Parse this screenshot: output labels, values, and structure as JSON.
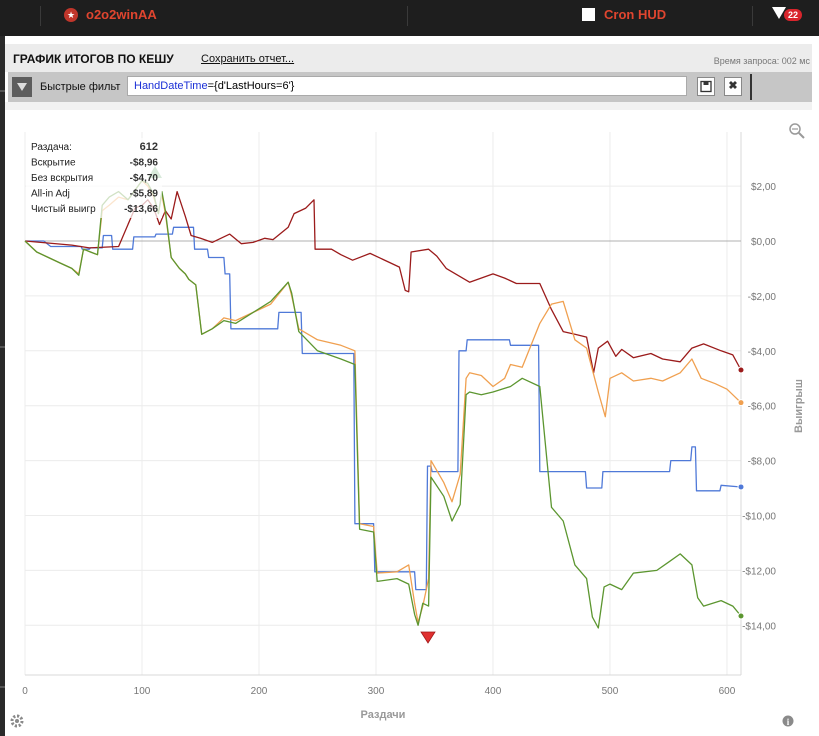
{
  "topbar": {
    "player": "o2o2winAA",
    "hud_label": "Cron HUD",
    "badge_count": "22"
  },
  "header": {
    "title": "ГРАФИК ИТОГОВ ПО КЕШУ",
    "save_link": "Сохранить отчет...",
    "query_time": "Время запроса: 002 мс"
  },
  "filter": {
    "label": "Быстрые фильт",
    "field": "HandDateTime",
    "value": "{d'LastHours=6'}"
  },
  "tooltip": {
    "rows": [
      {
        "label": "Раздача:",
        "value": "612"
      },
      {
        "label": "Вскрытие",
        "value": "-$8,96"
      },
      {
        "label": "Без вскрытия",
        "value": "-$4,70"
      },
      {
        "label": "All-in Adj",
        "value": "-$5,89"
      },
      {
        "label": "Чистый выигр",
        "value": "-$13,66"
      }
    ]
  },
  "colors": {
    "showdown": "#4f79d8",
    "non_showdown": "#9b1b1b",
    "allin_adj": "#f0a050",
    "net": "#5c9630",
    "zero_line": "#b0b0b0",
    "grid": "#ececec"
  },
  "chart_data": {
    "type": "line",
    "xlabel": "Раздачи",
    "ylabel": "Выигрыш",
    "xlim": [
      0,
      612
    ],
    "ylim": [
      -15,
      3
    ],
    "x_ticks": [
      0,
      100,
      200,
      300,
      400,
      500,
      600
    ],
    "x_tick_labels": [
      "0",
      "100",
      "200",
      "300",
      "400",
      "500",
      "600"
    ],
    "y_ticks": [
      2,
      0,
      -2,
      -4,
      -6,
      -8,
      -10,
      -12,
      -14
    ],
    "y_tick_labels": [
      "$2,00",
      "$0,00",
      "-$2,00",
      "-$4,00",
      "-$6,00",
      "-$8,00",
      "-$10,00",
      "-$12,00",
      "-$14,00"
    ],
    "grid": true,
    "series": [
      {
        "name": "Вскрытие",
        "color": "#4f79d8",
        "points": [
          [
            0,
            0
          ],
          [
            16,
            0
          ],
          [
            22,
            -0.2
          ],
          [
            48,
            -0.2
          ],
          [
            49,
            -0.3
          ],
          [
            55,
            -0.3
          ],
          [
            56,
            -0.25
          ],
          [
            66,
            -0.25
          ],
          [
            67,
            0.2
          ],
          [
            74,
            0.2
          ],
          [
            75,
            -0.3
          ],
          [
            92,
            -0.3
          ],
          [
            93,
            0.15
          ],
          [
            111,
            0.15
          ],
          [
            112,
            0.25
          ],
          [
            126,
            0.25
          ],
          [
            127,
            0.5
          ],
          [
            144,
            0.5
          ],
          [
            145,
            -0.3
          ],
          [
            156,
            -0.3
          ],
          [
            157,
            -0.6
          ],
          [
            170,
            -0.6
          ],
          [
            171,
            -1.2
          ],
          [
            175,
            -1.2
          ],
          [
            176,
            -3.2
          ],
          [
            216,
            -3.2
          ],
          [
            217,
            -2.6
          ],
          [
            236,
            -2.6
          ],
          [
            237,
            -4.1
          ],
          [
            281,
            -4.1
          ],
          [
            282,
            -10.3
          ],
          [
            298,
            -10.3
          ],
          [
            299,
            -12.05
          ],
          [
            333,
            -12.05
          ],
          [
            334,
            -12.7
          ],
          [
            343,
            -12.7
          ],
          [
            344,
            -8.2
          ],
          [
            347,
            -8.2
          ],
          [
            348,
            -8.4
          ],
          [
            370,
            -8.4
          ],
          [
            371,
            -4.0
          ],
          [
            377,
            -4.0
          ],
          [
            378,
            -3.6
          ],
          [
            414,
            -3.6
          ],
          [
            415,
            -3.8
          ],
          [
            439,
            -3.8
          ],
          [
            440,
            -8.4
          ],
          [
            479,
            -8.4
          ],
          [
            480,
            -9.0
          ],
          [
            493,
            -9.0
          ],
          [
            494,
            -8.4
          ],
          [
            551,
            -8.4
          ],
          [
            552,
            -8.0
          ],
          [
            569,
            -8.0
          ],
          [
            570,
            -7.5
          ],
          [
            573,
            -7.5
          ],
          [
            574,
            -9.1
          ],
          [
            594,
            -9.1
          ],
          [
            595,
            -8.9
          ],
          [
            612,
            -8.96
          ]
        ]
      },
      {
        "name": "Без вскрытия",
        "color": "#9b1b1b",
        "points": [
          [
            0,
            0
          ],
          [
            40,
            -0.15
          ],
          [
            55,
            -0.25
          ],
          [
            80,
            -0.2
          ],
          [
            94,
            1.2
          ],
          [
            100,
            1.3
          ],
          [
            105,
            1.5
          ],
          [
            110,
            1.2
          ],
          [
            115,
            0.6
          ],
          [
            120,
            1.1
          ],
          [
            125,
            0.8
          ],
          [
            130,
            1.8
          ],
          [
            137,
            0.9
          ],
          [
            142,
            0.2
          ],
          [
            150,
            0.1
          ],
          [
            160,
            -0.05
          ],
          [
            175,
            0.25
          ],
          [
            185,
            -0.1
          ],
          [
            195,
            -0.05
          ],
          [
            205,
            0.1
          ],
          [
            212,
            0.05
          ],
          [
            225,
            0.5
          ],
          [
            230,
            1.0
          ],
          [
            240,
            1.2
          ],
          [
            247,
            1.5
          ],
          [
            248,
            -0.3
          ],
          [
            262,
            -0.3
          ],
          [
            270,
            -0.5
          ],
          [
            280,
            -0.7
          ],
          [
            295,
            -0.45
          ],
          [
            310,
            -0.75
          ],
          [
            320,
            -0.95
          ],
          [
            325,
            -1.8
          ],
          [
            328,
            -1.85
          ],
          [
            330,
            -0.4
          ],
          [
            345,
            -0.3
          ],
          [
            352,
            -0.55
          ],
          [
            360,
            -1.0
          ],
          [
            370,
            -1.25
          ],
          [
            380,
            -1.5
          ],
          [
            400,
            -1.2
          ],
          [
            410,
            -1.35
          ],
          [
            420,
            -1.55
          ],
          [
            440,
            -1.55
          ],
          [
            450,
            -2.5
          ],
          [
            460,
            -3.3
          ],
          [
            470,
            -3.4
          ],
          [
            480,
            -3.5
          ],
          [
            486,
            -4.8
          ],
          [
            490,
            -3.9
          ],
          [
            498,
            -3.65
          ],
          [
            505,
            -4.2
          ],
          [
            510,
            -3.95
          ],
          [
            520,
            -4.25
          ],
          [
            535,
            -4.1
          ],
          [
            545,
            -4.3
          ],
          [
            560,
            -4.4
          ],
          [
            570,
            -3.9
          ],
          [
            580,
            -3.75
          ],
          [
            595,
            -4.0
          ],
          [
            605,
            -4.15
          ],
          [
            612,
            -4.7
          ]
        ]
      },
      {
        "name": "All-in Adj",
        "color": "#f0a050",
        "points": [
          [
            0,
            0
          ],
          [
            10,
            -0.4
          ],
          [
            20,
            -0.6
          ],
          [
            30,
            -0.8
          ],
          [
            40,
            -1.0
          ],
          [
            46,
            -1.2
          ],
          [
            50,
            -0.3
          ],
          [
            56,
            -0.4
          ],
          [
            62,
            -0.5
          ],
          [
            66,
            1.1
          ],
          [
            72,
            1.3
          ],
          [
            80,
            1.6
          ],
          [
            88,
            1.5
          ],
          [
            95,
            1.9
          ],
          [
            100,
            2.2
          ],
          [
            105,
            2.0
          ],
          [
            110,
            1.6
          ],
          [
            114,
            1.0
          ],
          [
            117,
            1.7
          ],
          [
            120,
            1.0
          ],
          [
            125,
            -0.6
          ],
          [
            132,
            -1.0
          ],
          [
            137,
            -1.2
          ],
          [
            140,
            -1.4
          ],
          [
            146,
            -1.6
          ],
          [
            151,
            -3.4
          ],
          [
            160,
            -3.2
          ],
          [
            170,
            -2.8
          ],
          [
            180,
            -2.9
          ],
          [
            195,
            -2.6
          ],
          [
            210,
            -2.3
          ],
          [
            225,
            -1.5
          ],
          [
            228,
            -2.0
          ],
          [
            234,
            -3.2
          ],
          [
            250,
            -3.6
          ],
          [
            270,
            -3.8
          ],
          [
            282,
            -4.0
          ],
          [
            286,
            -10.3
          ],
          [
            298,
            -10.4
          ],
          [
            301,
            -12.1
          ],
          [
            318,
            -12.05
          ],
          [
            328,
            -11.8
          ],
          [
            333,
            -13.2
          ],
          [
            336,
            -13.9
          ],
          [
            340,
            -13.3
          ],
          [
            345,
            -12.3
          ],
          [
            347,
            -8.0
          ],
          [
            358,
            -8.8
          ],
          [
            365,
            -9.5
          ],
          [
            372,
            -8.5
          ],
          [
            377,
            -5.0
          ],
          [
            380,
            -4.8
          ],
          [
            390,
            -4.9
          ],
          [
            400,
            -5.3
          ],
          [
            410,
            -5.0
          ],
          [
            415,
            -4.5
          ],
          [
            425,
            -4.6
          ],
          [
            440,
            -3.0
          ],
          [
            450,
            -2.3
          ],
          [
            460,
            -2.2
          ],
          [
            470,
            -3.6
          ],
          [
            480,
            -3.9
          ],
          [
            490,
            -5.5
          ],
          [
            496,
            -6.4
          ],
          [
            500,
            -5.0
          ],
          [
            510,
            -4.8
          ],
          [
            520,
            -5.1
          ],
          [
            535,
            -5.0
          ],
          [
            545,
            -5.1
          ],
          [
            560,
            -4.8
          ],
          [
            570,
            -4.3
          ],
          [
            578,
            -5.0
          ],
          [
            590,
            -5.2
          ],
          [
            600,
            -5.4
          ],
          [
            612,
            -5.89
          ]
        ]
      },
      {
        "name": "Чистый выигрыш",
        "color": "#5c9630",
        "points": [
          [
            0,
            0
          ],
          [
            10,
            -0.4
          ],
          [
            20,
            -0.6
          ],
          [
            30,
            -0.8
          ],
          [
            40,
            -1.0
          ],
          [
            46,
            -1.25
          ],
          [
            50,
            -0.3
          ],
          [
            56,
            -0.4
          ],
          [
            62,
            -0.5
          ],
          [
            66,
            1.3
          ],
          [
            72,
            1.6
          ],
          [
            80,
            1.8
          ],
          [
            88,
            1.5
          ],
          [
            95,
            1.9
          ],
          [
            100,
            2.2
          ],
          [
            105,
            2.1
          ],
          [
            110,
            1.7
          ],
          [
            114,
            1.0
          ],
          [
            117,
            1.8
          ],
          [
            120,
            1.1
          ],
          [
            125,
            -0.6
          ],
          [
            132,
            -1.0
          ],
          [
            137,
            -1.2
          ],
          [
            140,
            -1.4
          ],
          [
            146,
            -1.6
          ],
          [
            151,
            -3.4
          ],
          [
            160,
            -3.2
          ],
          [
            170,
            -2.9
          ],
          [
            180,
            -3.0
          ],
          [
            195,
            -2.6
          ],
          [
            210,
            -2.2
          ],
          [
            225,
            -1.5
          ],
          [
            228,
            -1.9
          ],
          [
            234,
            -3.3
          ],
          [
            250,
            -4.0
          ],
          [
            270,
            -4.3
          ],
          [
            282,
            -4.5
          ],
          [
            286,
            -10.5
          ],
          [
            298,
            -10.6
          ],
          [
            301,
            -12.4
          ],
          [
            318,
            -12.3
          ],
          [
            328,
            -12.5
          ],
          [
            333,
            -13.6
          ],
          [
            336,
            -14.0
          ],
          [
            340,
            -13.2
          ],
          [
            345,
            -13.3
          ],
          [
            347,
            -8.6
          ],
          [
            358,
            -9.3
          ],
          [
            365,
            -10.2
          ],
          [
            372,
            -9.6
          ],
          [
            377,
            -5.6
          ],
          [
            380,
            -5.5
          ],
          [
            390,
            -5.6
          ],
          [
            400,
            -5.5
          ],
          [
            415,
            -5.3
          ],
          [
            425,
            -5.0
          ],
          [
            440,
            -5.3
          ],
          [
            450,
            -9.7
          ],
          [
            460,
            -10.2
          ],
          [
            470,
            -11.8
          ],
          [
            480,
            -12.3
          ],
          [
            485,
            -13.7
          ],
          [
            490,
            -14.1
          ],
          [
            495,
            -12.6
          ],
          [
            500,
            -12.5
          ],
          [
            510,
            -12.7
          ],
          [
            520,
            -12.1
          ],
          [
            540,
            -12.0
          ],
          [
            550,
            -11.7
          ],
          [
            560,
            -11.4
          ],
          [
            570,
            -11.8
          ],
          [
            575,
            -13.0
          ],
          [
            580,
            -13.3
          ],
          [
            595,
            -13.1
          ],
          [
            605,
            -13.3
          ],
          [
            612,
            -13.66
          ]
        ]
      }
    ]
  }
}
